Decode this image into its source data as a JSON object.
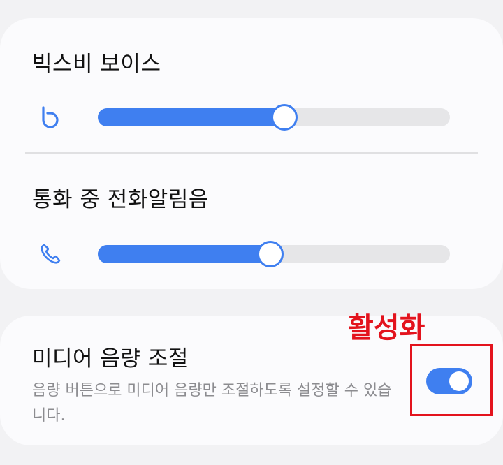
{
  "sections": {
    "bixby": {
      "title": "빅스비 보이스",
      "icon": "bixby-icon",
      "level": 0.53
    },
    "ringtone_in_call": {
      "title": "통화 중 전화알림음",
      "icon": "phone-icon",
      "level": 0.49
    },
    "media_volume": {
      "title": "미디어 음량 조절",
      "description": "음량 버튼으로 미디어 음량만 조절하도록 설정할 수 있습니다.",
      "toggle_on": true
    }
  },
  "annotation": {
    "label": "활성화",
    "color": "#e3131d"
  },
  "colors": {
    "accent": "#3f7ff0",
    "track": "#e6e6e8"
  }
}
